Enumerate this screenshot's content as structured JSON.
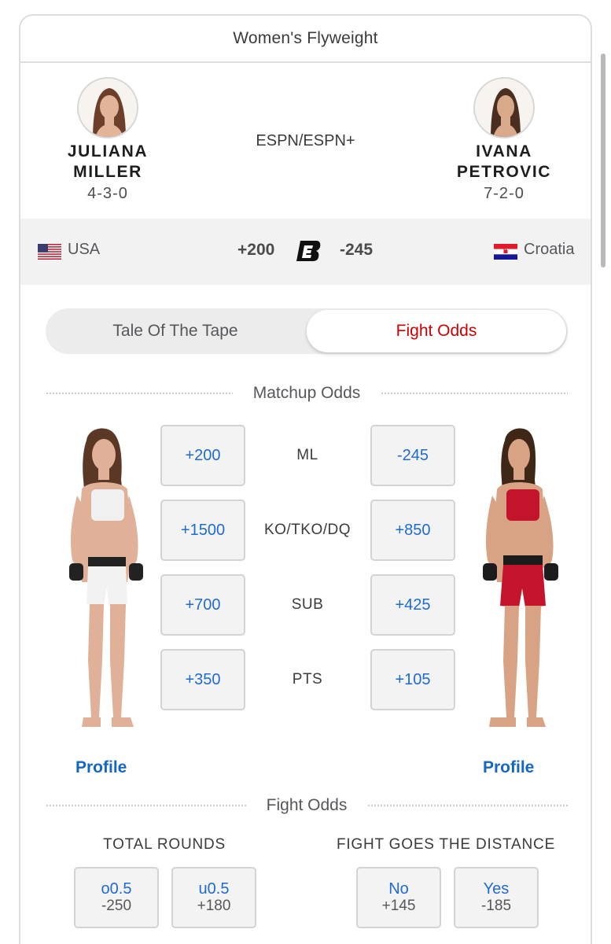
{
  "card_title": "Women's Flyweight",
  "broadcast": "ESPN/ESPN+",
  "fighter_left": {
    "first_name": "JULIANA",
    "last_name": "MILLER",
    "record": "4-3-0",
    "country": "USA",
    "moneyline": "+200",
    "profile_label": "Profile"
  },
  "fighter_right": {
    "first_name": "IVANA",
    "last_name": "PETROVIC",
    "record": "7-2-0",
    "country": "Croatia",
    "moneyline": "-245",
    "profile_label": "Profile"
  },
  "tabs": {
    "tape": "Tale Of The Tape",
    "odds": "Fight Odds",
    "active": "odds"
  },
  "matchup": {
    "title": "Matchup Odds",
    "markets": [
      {
        "label": "ML",
        "left": "+200",
        "right": "-245"
      },
      {
        "label": "KO/TKO/DQ",
        "left": "+1500",
        "right": "+850"
      },
      {
        "label": "SUB",
        "left": "+700",
        "right": "+425"
      },
      {
        "label": "PTS",
        "left": "+350",
        "right": "+105"
      }
    ]
  },
  "fight_odds": {
    "title": "Fight Odds",
    "total_rounds": {
      "title": "TOTAL ROUNDS",
      "options": [
        {
          "label": "o0.5",
          "odds": "-250"
        },
        {
          "label": "u0.5",
          "odds": "+180"
        }
      ]
    },
    "distance": {
      "title": "FIGHT GOES THE DISTANCE",
      "options": [
        {
          "label": "No",
          "odds": "+145"
        },
        {
          "label": "Yes",
          "odds": "-185"
        }
      ]
    }
  },
  "colors": {
    "accent_red": "#d00000",
    "link_blue": "#1567c5",
    "odds_blue": "#1f6bd0",
    "left_fighter_gear": "#f2f2f2",
    "right_fighter_gear": "#c4142b"
  },
  "icons": {
    "bet_logo": "espn-bet-logo-icon",
    "flag_left": "usa-flag-icon",
    "flag_right": "croatia-flag-icon"
  }
}
